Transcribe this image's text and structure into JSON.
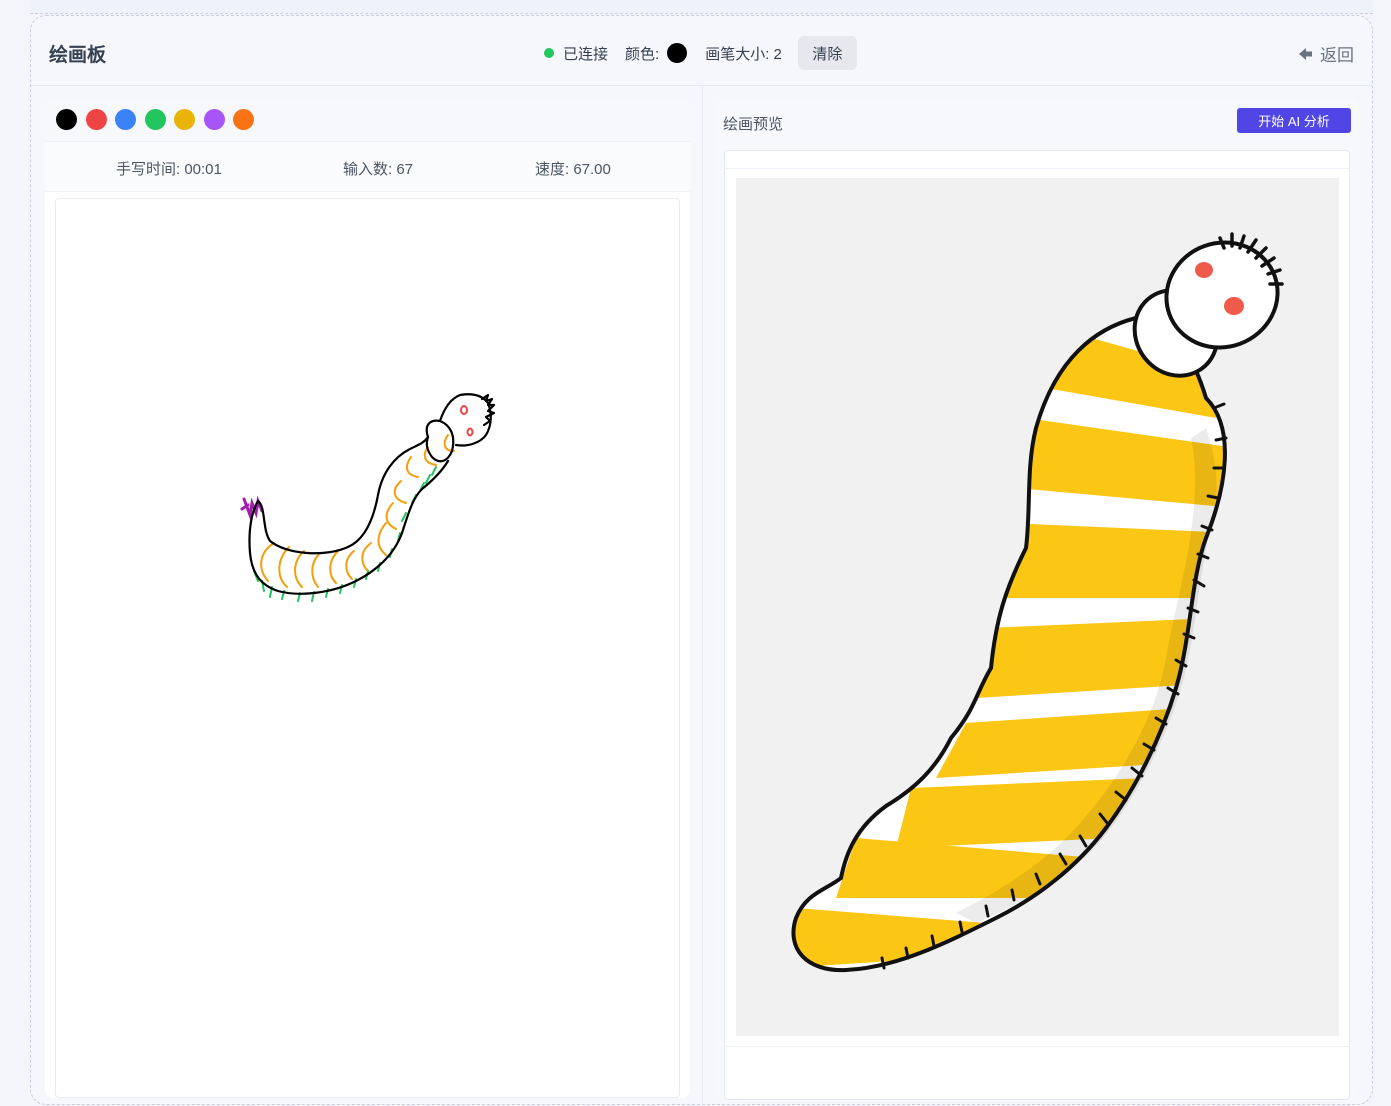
{
  "header": {
    "title": "绘画板",
    "connection_status": "已连接",
    "color_label": "颜色:",
    "current_color": "#000000",
    "brush_size_label": "画笔大小: 2",
    "clear_label": "清除",
    "back_label": "返回"
  },
  "palette": {
    "colors": [
      "#000000",
      "#ef4444",
      "#3b82f6",
      "#22c55e",
      "#eab308",
      "#a855f7",
      "#f97316"
    ]
  },
  "stats": {
    "time_label": "手写时间: 00:01",
    "input_label": "输入数: 67",
    "speed_label": "速度: 67.00"
  },
  "preview": {
    "label": "绘画预览",
    "analyze_label": "开始 AI 分析"
  }
}
